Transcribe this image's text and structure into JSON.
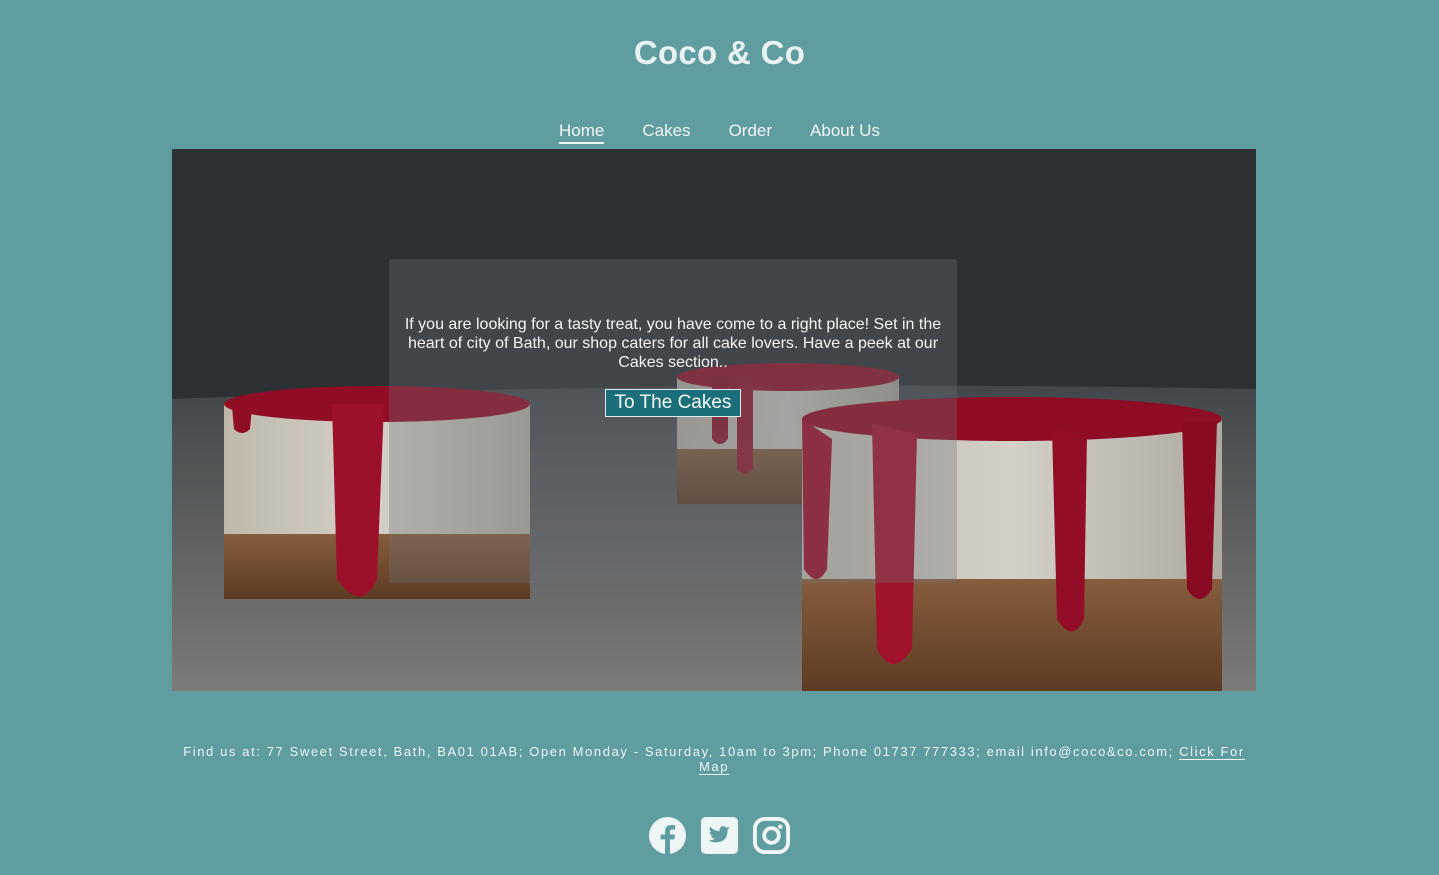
{
  "header": {
    "title": "Coco & Co"
  },
  "nav": {
    "items": [
      {
        "label": "Home",
        "active": true
      },
      {
        "label": "Cakes",
        "active": false
      },
      {
        "label": "Order",
        "active": false
      },
      {
        "label": "About Us",
        "active": false
      }
    ]
  },
  "hero": {
    "text": "If you are looking for a tasty treat, you have come to a right place! Set in the heart of city of Bath, our shop caters for all cake lovers. Have a peek at our Cakes section..",
    "button_label": "To The Cakes"
  },
  "footer": {
    "info": "Find us at: 77 Sweet Street, Bath, BA01 01AB; Open Monday - Saturday, 10am to 3pm; Phone 01737 777333; email info@coco&co.com; ",
    "map_link": "Click For Map",
    "social": [
      "facebook-icon",
      "twitter-icon",
      "instagram-icon"
    ]
  },
  "colors": {
    "background": "#5f9da0",
    "button": "#1a6f7a",
    "text": "#f2f6f6"
  }
}
